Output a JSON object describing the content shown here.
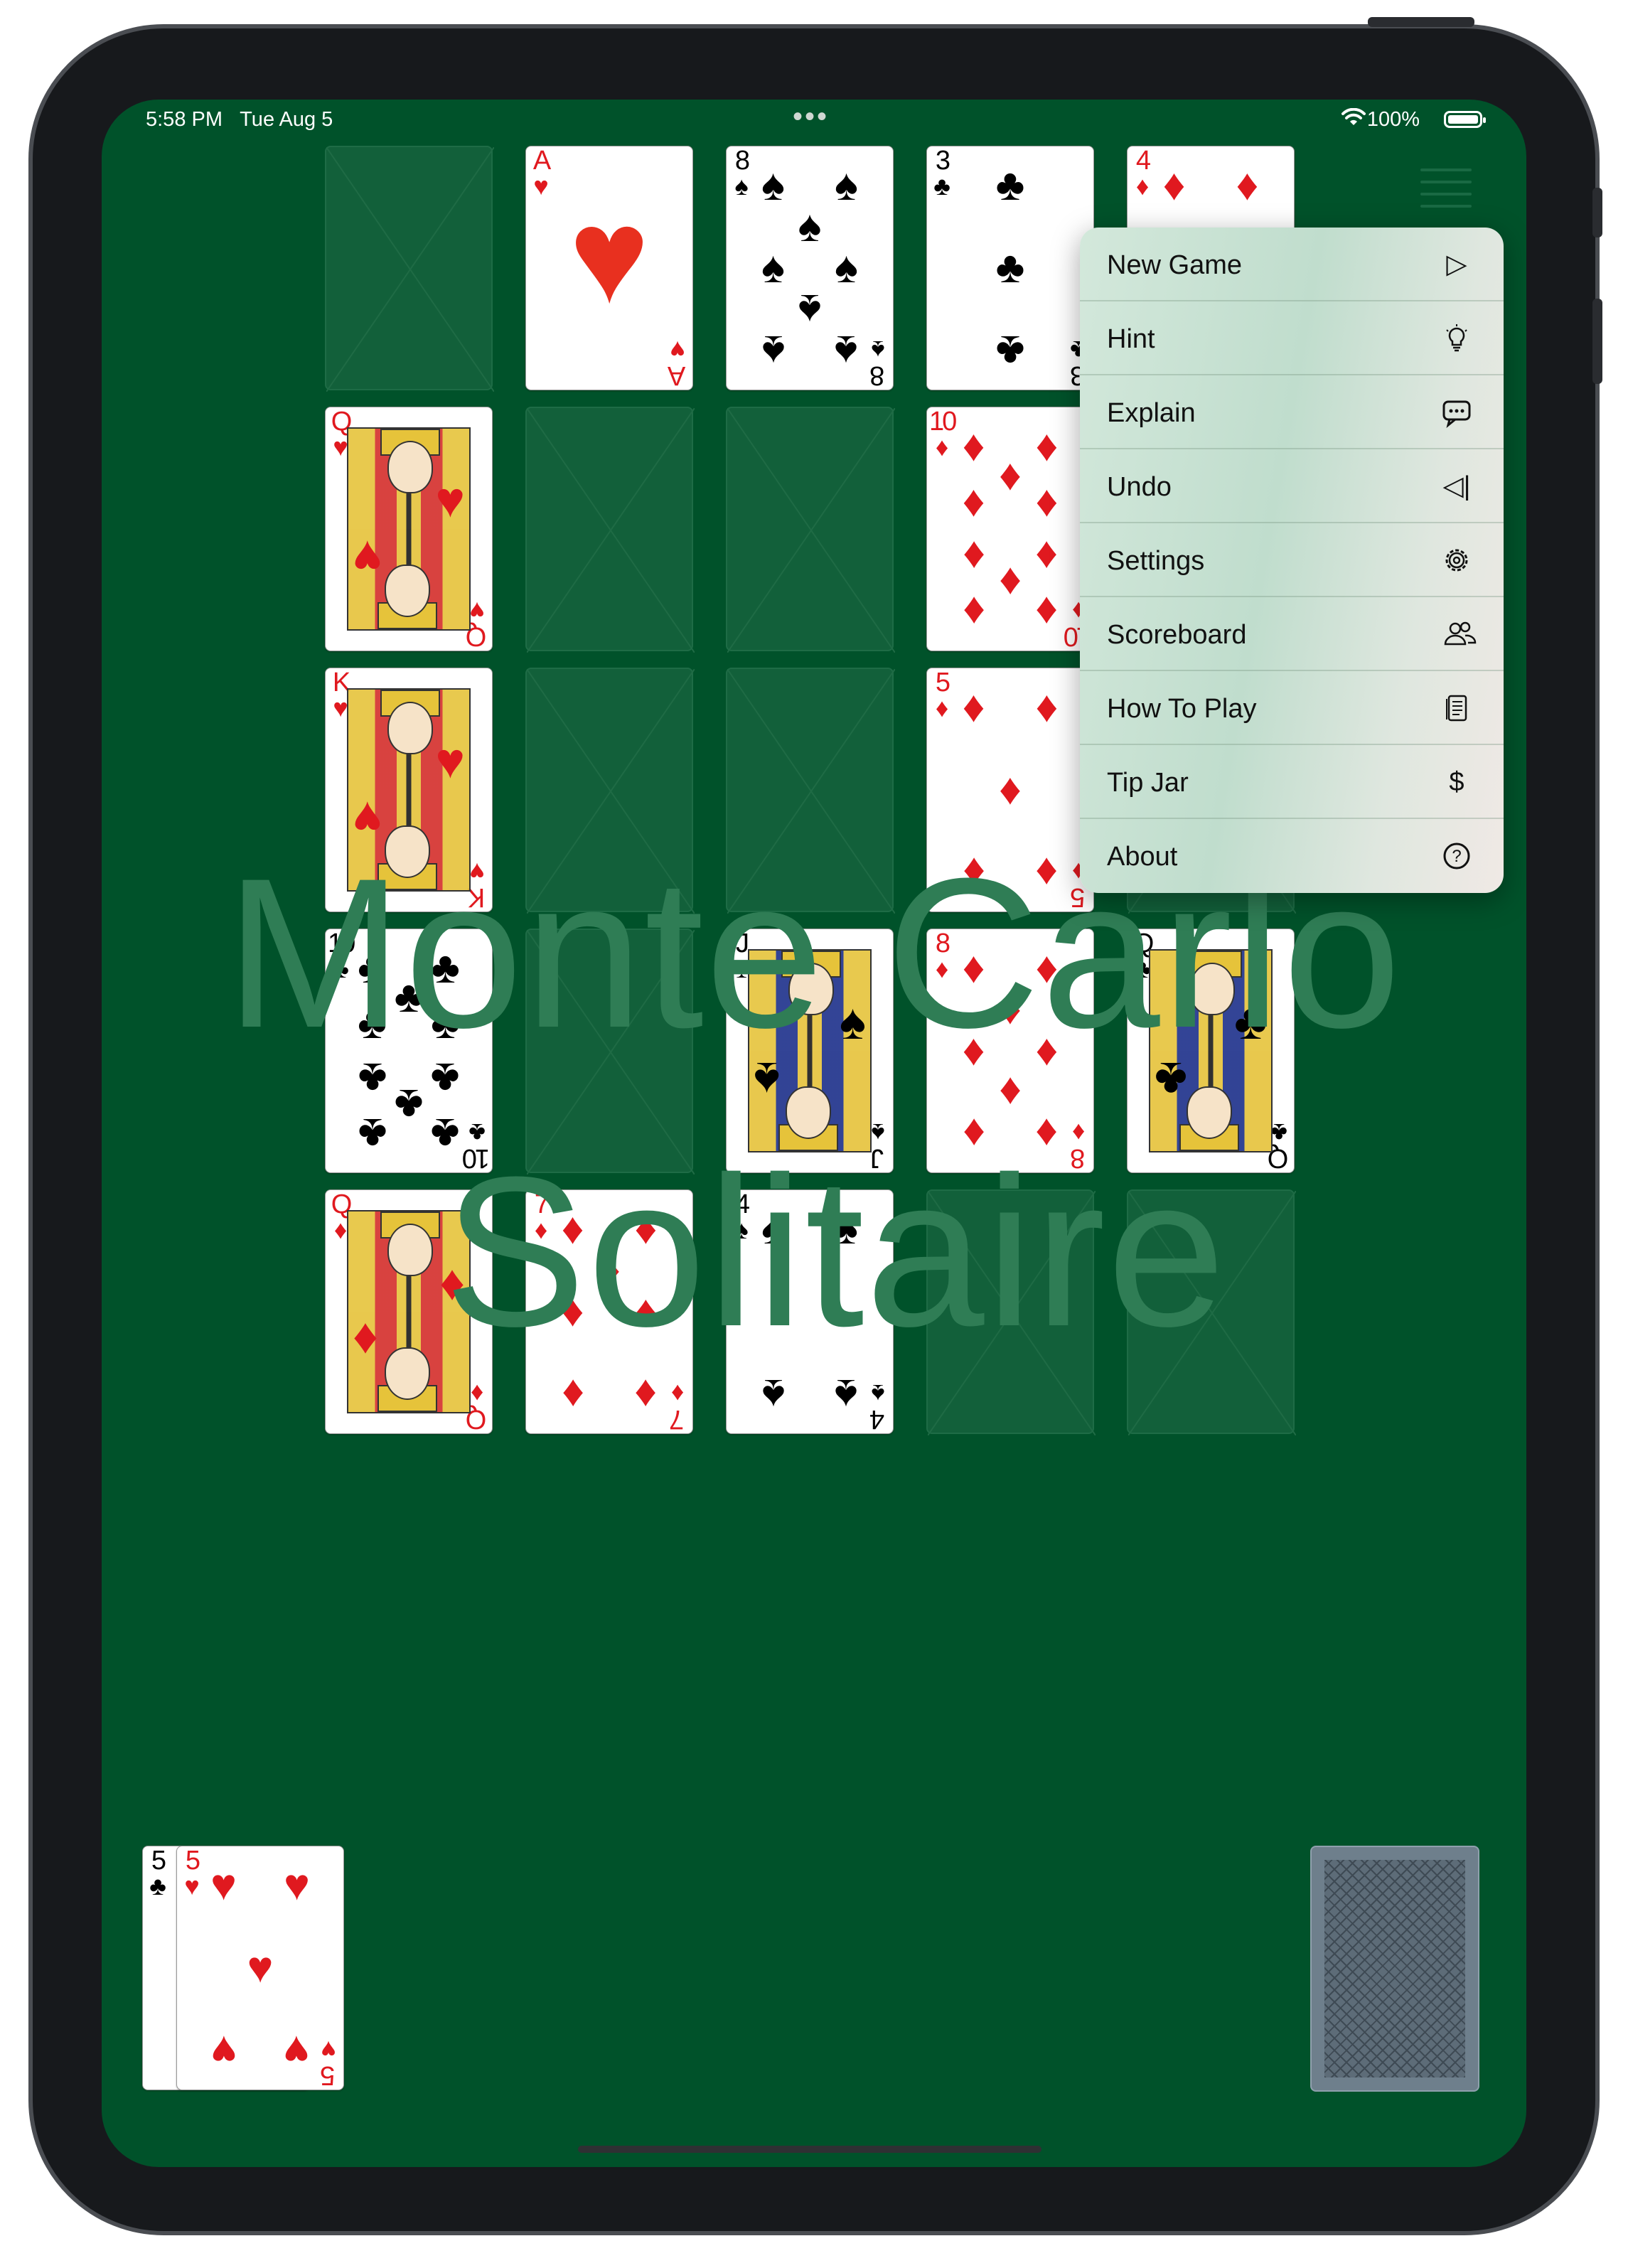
{
  "status_bar": {
    "time": "5:58 PM",
    "date": "Tue Aug 5",
    "battery": "100%",
    "multitask_indicator": "•••"
  },
  "app": {
    "title_line1": "Monte Carlo",
    "title_line2": "Solitaire"
  },
  "menu": {
    "items": [
      {
        "label": "New Game",
        "icon": "play-icon"
      },
      {
        "label": "Hint",
        "icon": "lightbulb-icon"
      },
      {
        "label": "Explain",
        "icon": "speech-bubble-icon"
      },
      {
        "label": "Undo",
        "icon": "undo-icon"
      },
      {
        "label": "Settings",
        "icon": "gear-icon"
      },
      {
        "label": "Scoreboard",
        "icon": "people-icon"
      },
      {
        "label": "How To Play",
        "icon": "document-icon"
      },
      {
        "label": "Tip Jar",
        "icon": "dollar-icon"
      },
      {
        "label": "About",
        "icon": "question-circle-icon"
      }
    ]
  },
  "tableau": {
    "rows": [
      [
        null,
        {
          "rank": "A",
          "suit": "♥"
        },
        {
          "rank": "8",
          "suit": "♠"
        },
        {
          "rank": "3",
          "suit": "♣"
        },
        {
          "rank": "4",
          "suit": "♦"
        }
      ],
      [
        {
          "rank": "Q",
          "suit": "♥"
        },
        null,
        null,
        {
          "rank": "10",
          "suit": "♦"
        },
        null
      ],
      [
        {
          "rank": "K",
          "suit": "♥"
        },
        null,
        null,
        {
          "rank": "5",
          "suit": "♦"
        },
        null
      ],
      [
        {
          "rank": "10",
          "suit": "♣"
        },
        null,
        {
          "rank": "J",
          "suit": "♠"
        },
        {
          "rank": "8",
          "suit": "♦"
        },
        {
          "rank": "Q",
          "suit": "♣"
        }
      ],
      [
        {
          "rank": "Q",
          "suit": "♦"
        },
        {
          "rank": "7",
          "suit": "♦"
        },
        {
          "rank": "4",
          "suit": "♠"
        },
        null,
        null
      ]
    ]
  },
  "waste": [
    {
      "rank": "5",
      "suit": "♣"
    },
    {
      "rank": "5",
      "suit": "♥"
    }
  ],
  "stock": {
    "face_down": true
  }
}
